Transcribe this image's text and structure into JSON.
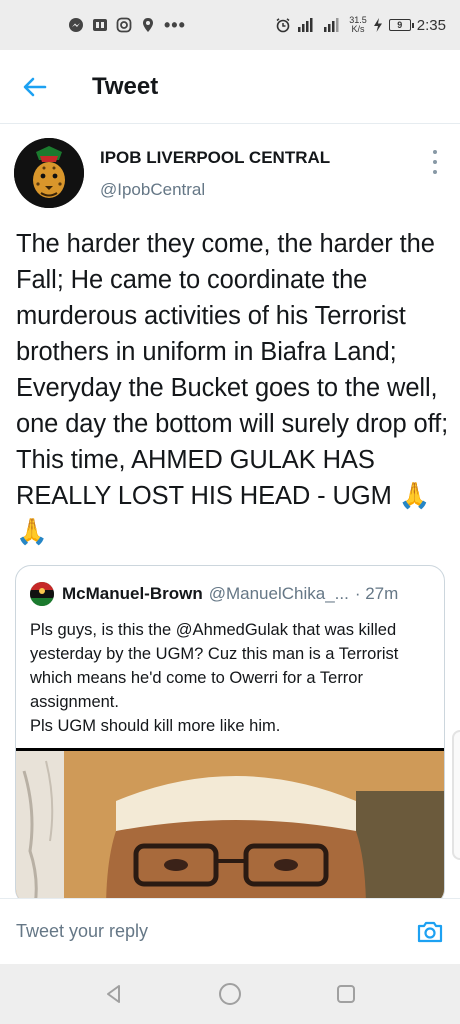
{
  "status_bar": {
    "network_speed_value": "31.5",
    "network_speed_unit": "K/s",
    "battery_level": "9",
    "time": "2:35",
    "icons": [
      "messenger-icon",
      "app-icon",
      "instagram-icon",
      "location-icon",
      "more-notifications-icon",
      "alarm-icon",
      "signal-icon",
      "signal-icon",
      "charging-icon",
      "battery-icon"
    ]
  },
  "header": {
    "title": "Tweet"
  },
  "tweet": {
    "author_name": "IPOB LIVERPOOL CENTRAL",
    "author_handle": "@IpobCentral",
    "text": "The harder they come, the harder the Fall; He came to coordinate the murderous activities of his Terrorist brothers in uniform in Biafra Land; Everyday the Bucket goes to the well, one day the bottom will surely drop off; This time, AHMED GULAK HAS REALLY LOST HIS HEAD - UGM 🙏🙏"
  },
  "quoted_tweet": {
    "author_name": "McManuel-Brown",
    "author_handle": "@ManuelChika_...",
    "time": "· 27m",
    "text_line1": "Pls guys, is this the @AhmedGulak that was killed yesterday by the UGM? Cuz this man is a Terrorist which means he'd come to Owerri for a Terror assignment.",
    "text_line2": "Pls UGM should kill more like him."
  },
  "reply": {
    "placeholder": "Tweet your reply"
  },
  "colors": {
    "accent": "#1da1f2",
    "handle_gray": "#657786"
  }
}
